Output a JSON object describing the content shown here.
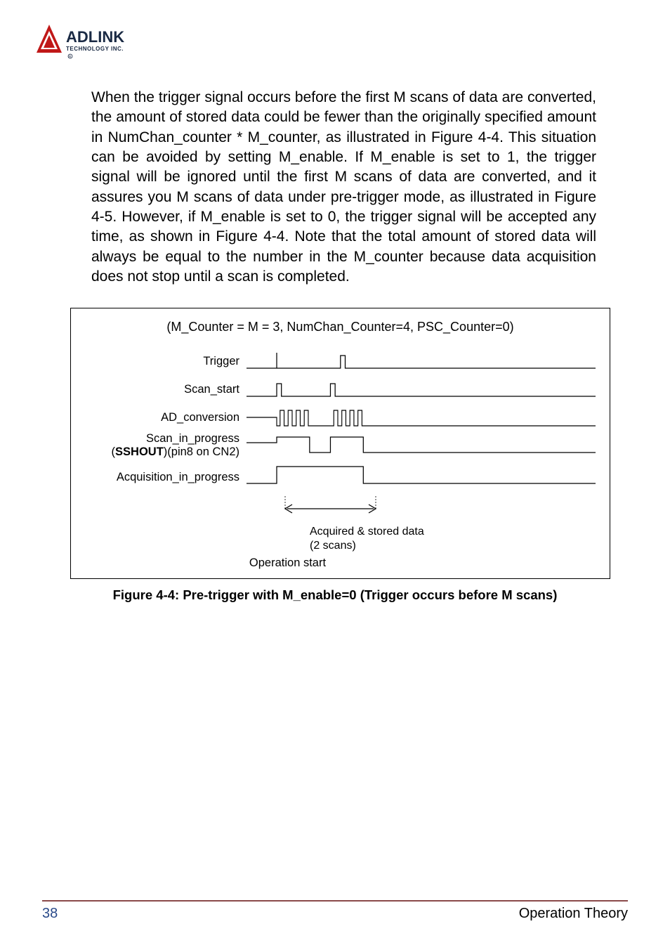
{
  "logo": {
    "line1": "ADLINK",
    "line2": "TECHNOLOGY INC."
  },
  "body_paragraph": "When the trigger signal occurs before the first M scans of data are converted, the amount of stored data could be fewer than the originally specified amount in NumChan_counter * M_counter, as illustrated in Figure 4-4. This situation can be avoided by setting M_enable. If M_enable is set to 1, the trigger signal will be ignored until the first M scans of data are converted, and it assures you M scans of data under pre-trigger mode, as illustrated in Figure 4-5. However, if M_enable is set to 0, the trigger signal will be accepted any time, as shown in Figure 4-4. Note that the total amount of stored data will always be equal to the number in the M_counter because data acquisition does not stop until a scan is completed.",
  "figure": {
    "title": "(M_Counter = M = 3, NumChan_Counter=4, PSC_Counter=0)",
    "signals": {
      "trigger": "Trigger",
      "scan_start": "Scan_start",
      "ad_conversion": "AD_conversion",
      "scan_in_progress_a": "Scan_in_progress",
      "scan_in_progress_b": "SSHOUT",
      "scan_in_progress_c": ")(pin8 on CN2)",
      "acq_in_progress": "Acquisition_in_progress"
    },
    "annotation_line1": "Acquired & stored data",
    "annotation_line2": "(2 scans)",
    "operation_start": "Operation start",
    "caption": "Figure 4-4: Pre-trigger with M_enable=0 (Trigger occurs before M scans)"
  },
  "footer": {
    "page": "38",
    "section": "Operation Theory"
  }
}
